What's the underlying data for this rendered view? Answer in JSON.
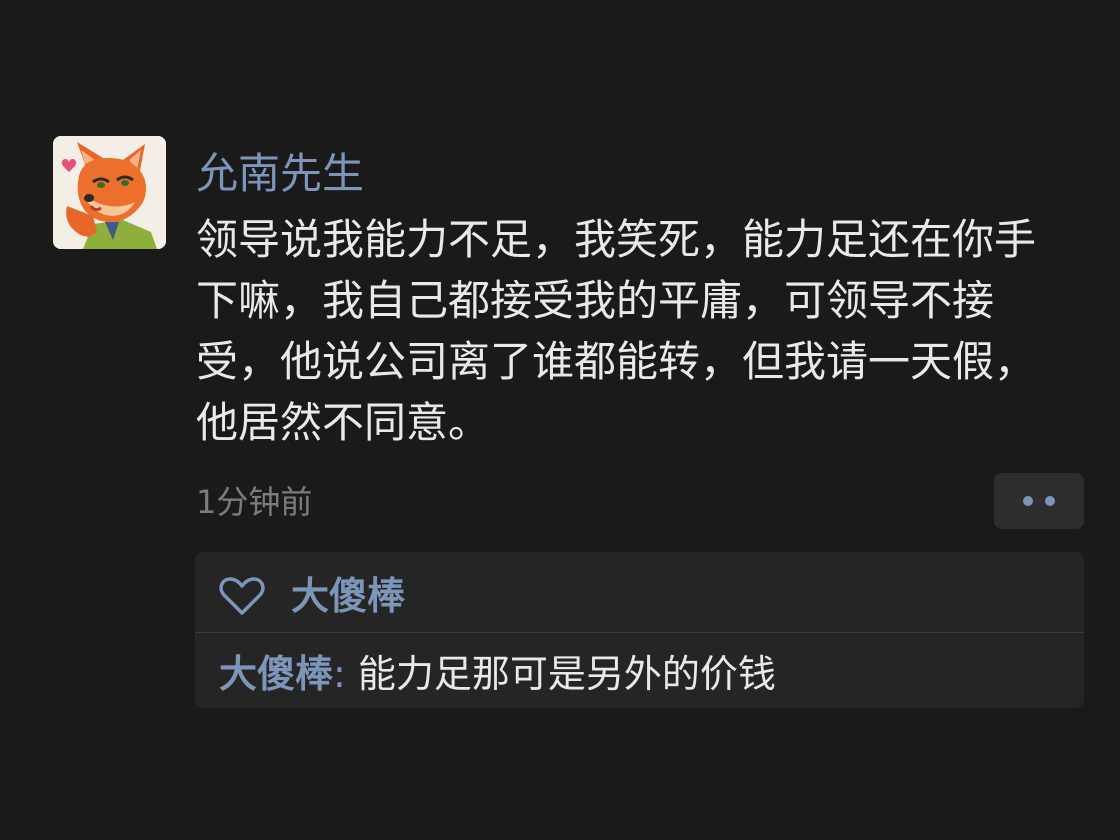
{
  "post": {
    "avatar_icon": "fox-avatar-icon",
    "username": "允南先生",
    "text": "领导说我能力不足，我笑死，能力足还在你手下嘛，我自己都接受我的平庸，可领导不接受，他说公司离了谁都能转，但我请一天假，他居然不同意。",
    "timestamp": "1分钟前",
    "more_icon": "more-dots-icon"
  },
  "likes": {
    "icon": "heart-icon",
    "names": [
      "大傻棒"
    ]
  },
  "comments": [
    {
      "author": "大傻棒",
      "separator": ": ",
      "text": "能力足那可是另外的价钱"
    }
  ],
  "colors": {
    "background": "#1a1a1a",
    "name_accent": "#7d95b8",
    "body_text": "#e9e9e9",
    "muted_text": "#7c7c7c",
    "panel": "#252525"
  }
}
